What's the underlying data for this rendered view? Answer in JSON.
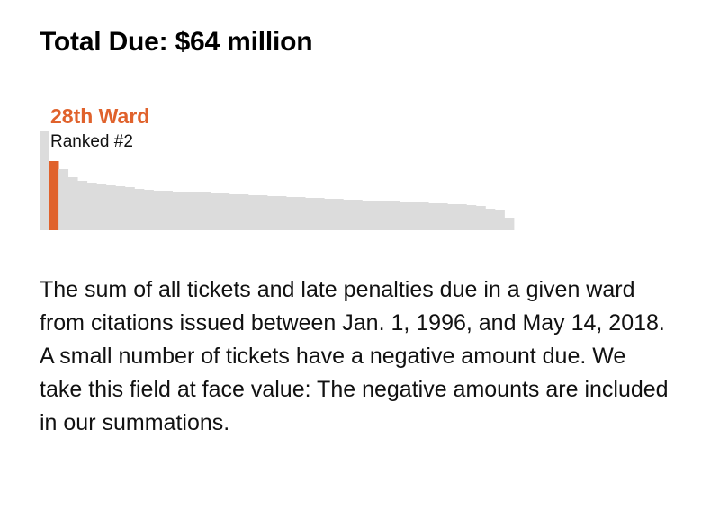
{
  "header": {
    "title": "Total Due: $64 million"
  },
  "chart_data": {
    "type": "bar",
    "highlight": {
      "label": "28th Ward",
      "rank_text": "Ranked #2",
      "rank": 2
    },
    "colors": {
      "highlight": "#e0622c",
      "bar": "#dcdcdc"
    },
    "values": [
      110,
      77,
      68,
      59,
      55,
      53,
      51,
      50,
      49,
      48,
      46,
      45,
      44,
      44,
      43,
      43,
      42,
      42,
      41,
      41,
      40,
      40,
      39,
      39,
      38,
      38,
      37,
      37,
      36,
      36,
      35,
      35,
      34,
      34,
      33,
      33,
      32,
      32,
      31,
      31,
      31,
      30,
      30,
      29,
      29,
      28,
      27,
      24,
      22,
      14
    ],
    "ylim": [
      0,
      110
    ]
  },
  "description": "The sum of all tickets and late penalties due in a given ward from citations issued between Jan. 1, 1996, and May 14, 2018. A small number of tickets have a negative amount due. We take this field at face value: The negative amounts are included in our summations."
}
